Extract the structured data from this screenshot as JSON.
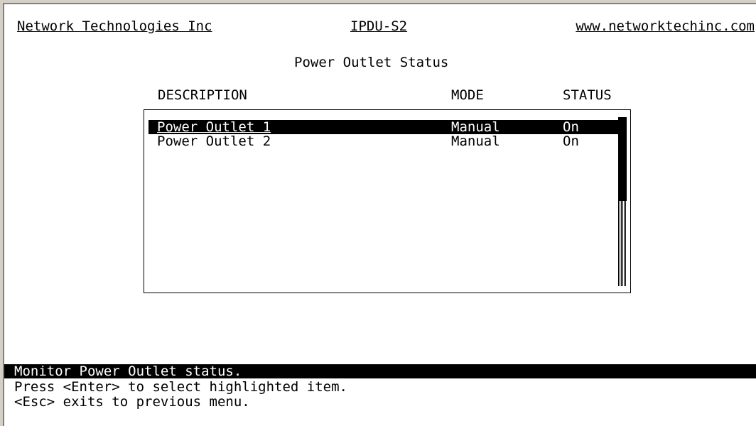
{
  "header": {
    "company": "Network Technologies Inc",
    "product": "IPDU-S2",
    "website": "www.networktechinc.com"
  },
  "page_title": "Power Outlet Status",
  "columns": {
    "description": "DESCRIPTION",
    "mode": "MODE",
    "status": "STATUS"
  },
  "outlets": [
    {
      "description": "Power Outlet 1",
      "mode": "Manual",
      "status": "On",
      "selected": true
    },
    {
      "description": "Power Outlet 2",
      "mode": "Manual",
      "status": "On",
      "selected": false
    }
  ],
  "footer": {
    "status_message": "Monitor Power Outlet status.",
    "help_enter": "Press <Enter> to select highlighted item.",
    "help_esc": "<Esc> exits to previous menu."
  },
  "colors": {
    "background": "#ffffff",
    "text": "#000000",
    "highlight_bg": "#000000",
    "highlight_text": "#ffffff",
    "window_frame": "#d4d0c8"
  }
}
